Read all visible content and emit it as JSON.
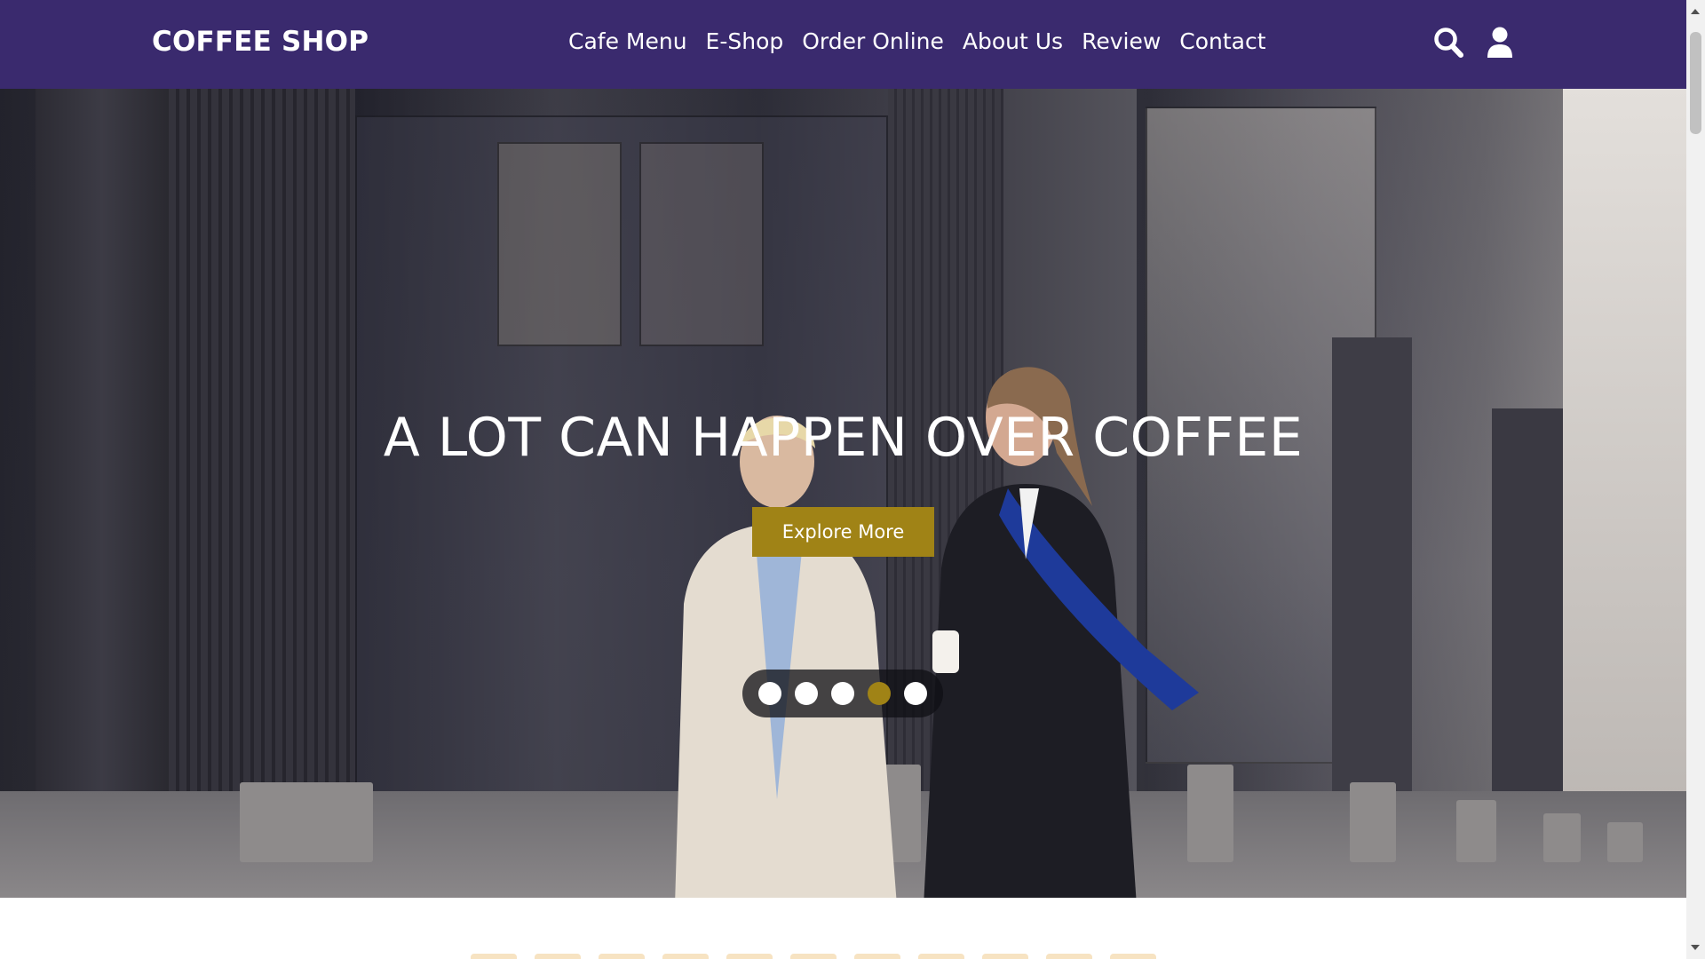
{
  "header": {
    "brand": "COFFEE SHOP",
    "nav": [
      "Cafe Menu",
      "E-Shop",
      "Order Online",
      "About Us",
      "Review",
      "Contact"
    ],
    "icons": [
      "search-icon",
      "user-icon"
    ]
  },
  "hero": {
    "title": "A LOT CAN HAPPEN OVER COFFEE",
    "button_label": "Explore More",
    "slides_total": 5,
    "active_slide": 4
  },
  "colors": {
    "navbar": "#3a2a6e",
    "accent": "#a08316",
    "text_on_dark": "#ffffff"
  }
}
